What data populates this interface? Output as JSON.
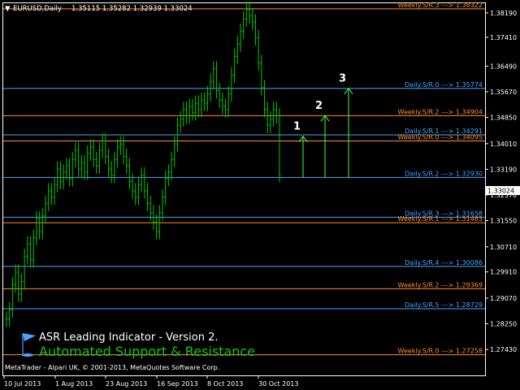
{
  "header": {
    "symbol": "EURUSD,Daily",
    "ohlc": "1.35115 1.35282 1.32939 1.33024"
  },
  "current_price": "1.33024",
  "colors": {
    "background": "#000000",
    "weekly": "#ff8c2b",
    "daily": "#4aa3ff",
    "candle": "#00c800",
    "arrow": "#3cff3c",
    "axis": "#ffffff"
  },
  "y_axis": {
    "min": 1.266,
    "max": 1.385,
    "ticks": [
      "1.38190",
      "1.37410",
      "1.36490",
      "1.35670",
      "1.34850",
      "1.34010",
      "1.33190",
      "1.32370",
      "1.31550",
      "1.30710",
      "1.29910",
      "1.29070",
      "1.28250",
      "1.27430"
    ]
  },
  "x_axis": {
    "ticks": [
      "10 Jul 2013",
      "1 Aug 2013",
      "23 Aug 2013",
      "16 Sep 2013",
      "8 Oct 2013",
      "30 Oct 2013"
    ]
  },
  "levels": [
    {
      "label": "Weekly.S/R.3 ---> 1.38322",
      "value": 1.38322,
      "kind": "weekly"
    },
    {
      "label": "Daily.S/R.0 ---> 1.35774",
      "value": 1.35774,
      "kind": "daily"
    },
    {
      "label": "Weekly.S/R.2 ---> 1.34904",
      "value": 1.34904,
      "kind": "weekly"
    },
    {
      "label": "Daily.S/R.1 ---> 1.34291",
      "value": 1.34291,
      "kind": "daily"
    },
    {
      "label": "Weekly.S/R.0 ---> 1.34095",
      "value": 1.34095,
      "kind": "weekly"
    },
    {
      "label": "Daily.S/R.2 ---> 1.32930",
      "value": 1.3293,
      "kind": "daily"
    },
    {
      "label": "Daily.S/R.3 ---> 1.31658",
      "value": 1.31658,
      "kind": "daily"
    },
    {
      "label": "Weekly.S/R.1 ---> 1.31483",
      "value": 1.31483,
      "kind": "weekly"
    },
    {
      "label": "Daily.S/R.4 ---> 1.30086",
      "value": 1.30086,
      "kind": "daily"
    },
    {
      "label": "Weekly.S/R.2 ---> 1.29369",
      "value": 1.29369,
      "kind": "weekly"
    },
    {
      "label": "Daily.S/R.5 ---> 1.28729",
      "value": 1.28729,
      "kind": "daily"
    },
    {
      "label": "Weekly.S/R.0 ---> 1.27258",
      "value": 1.27258,
      "kind": "weekly"
    }
  ],
  "arrows": [
    {
      "label": "1",
      "target": 1.3425
    },
    {
      "label": "2",
      "target": 1.3491
    },
    {
      "label": "3",
      "target": 1.3578
    }
  ],
  "arrow_base": 1.3293,
  "candles_close": [
    1.284,
    1.287,
    1.295,
    1.299,
    1.292,
    1.296,
    1.304,
    1.308,
    1.303,
    1.31,
    1.316,
    1.312,
    1.317,
    1.321,
    1.325,
    1.323,
    1.327,
    1.332,
    1.328,
    1.331,
    1.333,
    1.329,
    1.335,
    1.338,
    1.332,
    1.334,
    1.331,
    1.337,
    1.339,
    1.335,
    1.333,
    1.338,
    1.341,
    1.336,
    1.332,
    1.33,
    1.335,
    1.339,
    1.34,
    1.336,
    1.333,
    1.328,
    1.325,
    1.323,
    1.327,
    1.33,
    1.325,
    1.321,
    1.318,
    1.315,
    1.312,
    1.318,
    1.323,
    1.329,
    1.331,
    1.335,
    1.34,
    1.346,
    1.348,
    1.351,
    1.349,
    1.352,
    1.35,
    1.353,
    1.351,
    1.354,
    1.353,
    1.356,
    1.36,
    1.364,
    1.357,
    1.354,
    1.352,
    1.351,
    1.356,
    1.362,
    1.368,
    1.372,
    1.376,
    1.38,
    1.383,
    1.381,
    1.379,
    1.374,
    1.366,
    1.358,
    1.351,
    1.346,
    1.348,
    1.351,
    1.349,
    1.3302
  ],
  "indicator": {
    "title": "ASR Leading Indicator - Version 2.",
    "subtitle": "Automated Support & Resistance"
  },
  "footer": "MetaTrader - Alpari UK, © 2001-2013, MetaQuotes Software Corp."
}
